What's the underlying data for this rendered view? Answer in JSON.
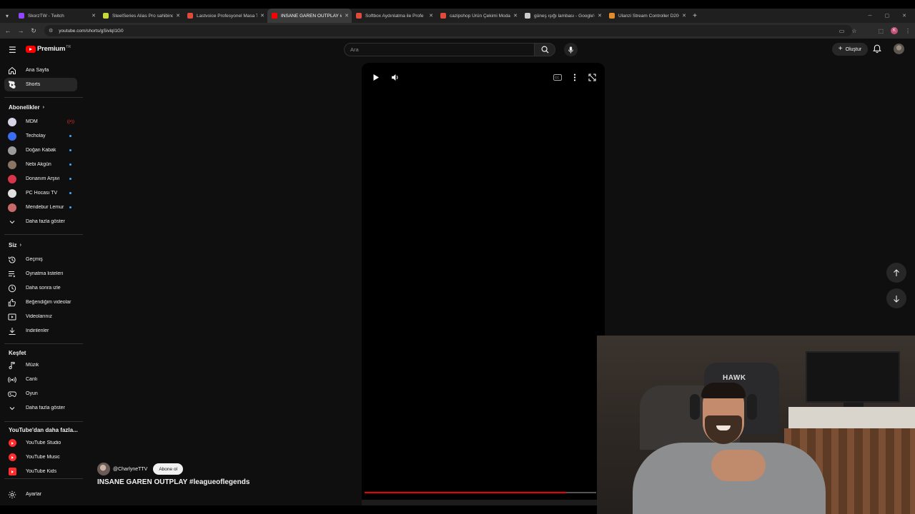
{
  "browser": {
    "tabs": [
      {
        "title": "SkorzTW - Twitch",
        "color": "#9146ff",
        "active": false
      },
      {
        "title": "SteelSeries Alias Pro sahibinden",
        "color": "#c7d93b",
        "active": false
      },
      {
        "title": "Lastvoice Profesyonel Masa Tipi",
        "color": "#e24a3b",
        "active": false
      },
      {
        "title": "INSANE GAREN OUTPLAY #leag",
        "color": "#ff0000",
        "active": true
      },
      {
        "title": "Softbox Aydınlatma ile Profe",
        "color": "#e24a3b",
        "active": false
      },
      {
        "title": "cazipshop Ürün Çekimi Moda",
        "color": "#e24a3b",
        "active": false
      },
      {
        "title": "güneş ışığı lambası - Google'da",
        "color": "#cccccc",
        "active": false
      },
      {
        "title": "Ulanzi Stream Controller D200",
        "color": "#e08c2a",
        "active": false
      }
    ],
    "url": "youtube.com/shorts/gSivlqI1G0",
    "profile_letter": "K"
  },
  "masthead": {
    "logo_text": "Premium",
    "logo_suffix": "TR",
    "search_placeholder": "Ara",
    "create_label": "Oluştur"
  },
  "sidebar": {
    "main": [
      {
        "label": "Ana Sayfa",
        "icon": "home-icon"
      },
      {
        "label": "Shorts",
        "icon": "shorts-icon",
        "active": true
      }
    ],
    "subscriptions_title": "Abonelikler",
    "subscriptions": [
      {
        "label": "MDM",
        "color": "#d9d3e6",
        "live": true
      },
      {
        "label": "Techolay",
        "color": "#3a6ef0",
        "dot": true
      },
      {
        "label": "Doğan Kabak",
        "color": "#9b9b9b",
        "dot": true
      },
      {
        "label": "Nebi Akgün",
        "color": "#8a7565",
        "dot": true
      },
      {
        "label": "Donanım Arşivi",
        "color": "#d8344a",
        "dot": true
      },
      {
        "label": "PC Hocası TV",
        "color": "#e0e0e0",
        "dot": true
      },
      {
        "label": "Mendebur Lemur",
        "color": "#c86a6a",
        "dot": true
      }
    ],
    "show_more": "Daha fazla göster",
    "you_title": "Siz",
    "you": [
      {
        "label": "Geçmiş",
        "icon": "history-icon"
      },
      {
        "label": "Oynatma listeleri",
        "icon": "playlists-icon"
      },
      {
        "label": "Daha sonra izle",
        "icon": "watch-later-icon"
      },
      {
        "label": "Beğendiğim videolar",
        "icon": "like-icon"
      },
      {
        "label": "Videolarınız",
        "icon": "your-videos-icon"
      },
      {
        "label": "İndirilenler",
        "icon": "download-icon"
      }
    ],
    "explore_title": "Keşfet",
    "explore": [
      {
        "label": "Müzik",
        "icon": "music-icon"
      },
      {
        "label": "Canlı",
        "icon": "live-icon"
      },
      {
        "label": "Oyun",
        "icon": "gaming-icon"
      }
    ],
    "explore_more": "Daha fazla göster",
    "more_title": "YouTube'dan daha fazla...",
    "more": [
      {
        "label": "YouTube Studio",
        "color": "#ff2d2d"
      },
      {
        "label": "YouTube Music",
        "color": "#ff2d2d"
      },
      {
        "label": "YouTube Kids",
        "color": "#ff2d2d"
      }
    ],
    "settings": "Ayarlar"
  },
  "short": {
    "channel": "@CharlyneTTV",
    "subscribe_label": "Abone ol",
    "title": "INSANE GAREN OUTPLAY #leagueoflegends"
  },
  "webcam": {
    "chair_logo": "HAWK"
  },
  "colors": {
    "background": "#0f0f0f",
    "accent": "#ff0000",
    "active_item": "#272727"
  }
}
